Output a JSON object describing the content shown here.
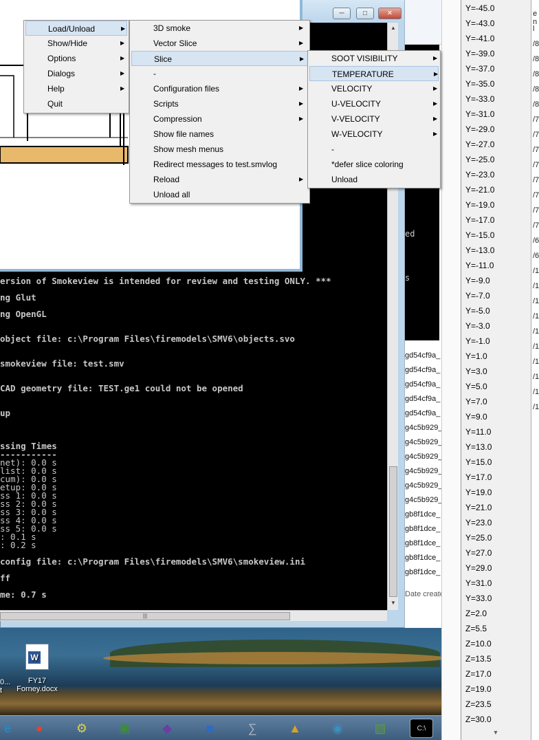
{
  "console": {
    "lines": [
      {
        "text": "ersion of Smokeview is intended for review and testing ONLY. ***",
        "bold": true
      },
      {
        "text": "ng Glut",
        "bold": true
      },
      {
        "text": "ng OpenGL",
        "bold": true
      },
      {
        "text": "object file: c:\\Program Files\\firemodels\\SMV6\\objects.svo",
        "bold": true
      },
      {
        "text": "smokeview file: test.smv",
        "bold": true
      },
      {
        "text": "CAD geometry file: TEST.ge1 could not be opened",
        "bold": true
      },
      {
        "text": "up",
        "bold": true
      },
      {
        "text": "ssing Times",
        "bold": true
      },
      {
        "text": "-----------",
        "bold": true
      },
      {
        "text": "net): 0.0 s",
        "bold": false
      },
      {
        "text": "list: 0.0 s",
        "bold": false
      },
      {
        "text": "cum): 0.0 s",
        "bold": false
      },
      {
        "text": "etup: 0.0 s",
        "bold": false
      },
      {
        "text": "ss 1: 0.0 s",
        "bold": false
      },
      {
        "text": "ss 2: 0.0 s",
        "bold": false
      },
      {
        "text": "ss 3: 0.0 s",
        "bold": false
      },
      {
        "text": "ss 4: 0.0 s",
        "bold": false
      },
      {
        "text": "ss 5: 0.0 s",
        "bold": false
      },
      {
        "text": ": 0.1 s",
        "bold": false
      },
      {
        "text": ": 0.2 s",
        "bold": false
      },
      {
        "text": "config file: c:\\Program Files\\firemodels\\SMV6\\smokeview.ini",
        "bold": true
      },
      {
        "text": "ff",
        "bold": true
      },
      {
        "text": "me: 0.7 s",
        "bold": true
      }
    ]
  },
  "explorer": {
    "pane_text": [
      "ed",
      "s"
    ],
    "files": [
      "gd54cf9a_",
      "gd54cf9a_",
      "gd54cf9a_",
      "gd54cf9a_",
      "gd54cf9a_",
      "g4c5b929_",
      "g4c5b929_",
      "g4c5b929_",
      "g4c5b929_",
      "g4c5b929_",
      "g4c5b929_",
      "gb8f1dce_",
      "gb8f1dce_",
      "gb8f1dce_",
      "gb8f1dce_",
      "gb8f1dce_"
    ],
    "date_col": "Date create"
  },
  "main_menu": {
    "items": [
      {
        "label": "Load/Unload",
        "submenu": true
      },
      {
        "label": "Show/Hide",
        "submenu": true
      },
      {
        "label": "Options",
        "submenu": true
      },
      {
        "label": "Dialogs",
        "submenu": true
      },
      {
        "label": "Help",
        "submenu": true
      },
      {
        "label": "Quit",
        "submenu": false
      }
    ]
  },
  "load_menu": {
    "items": [
      {
        "label": "3D smoke",
        "submenu": true
      },
      {
        "label": "Vector Slice",
        "submenu": true
      },
      {
        "label": "Slice",
        "submenu": true
      },
      {
        "label": "-",
        "submenu": false
      },
      {
        "label": "Configuration files",
        "submenu": true
      },
      {
        "label": "Scripts",
        "submenu": true
      },
      {
        "label": "Compression",
        "submenu": true
      },
      {
        "label": "Show file names",
        "submenu": false
      },
      {
        "label": "Show mesh menus",
        "submenu": false
      },
      {
        "label": "Redirect messages to test.smvlog",
        "submenu": false
      },
      {
        "label": "Reload",
        "submenu": true
      },
      {
        "label": "Unload all",
        "submenu": false
      }
    ]
  },
  "slice_menu": {
    "items": [
      {
        "label": "SOOT VISIBILITY",
        "submenu": true
      },
      {
        "label": "TEMPERATURE",
        "submenu": true
      },
      {
        "label": "VELOCITY",
        "submenu": true
      },
      {
        "label": "U-VELOCITY",
        "submenu": true
      },
      {
        "label": "V-VELOCITY",
        "submenu": true
      },
      {
        "label": "W-VELOCITY",
        "submenu": true
      },
      {
        "label": "-",
        "submenu": false
      },
      {
        "label": " *defer slice coloring",
        "submenu": false
      },
      {
        "label": "Unload",
        "submenu": false
      }
    ]
  },
  "temperature_menu": {
    "items": [
      "Y=-45.0",
      "Y=-43.0",
      "Y=-41.0",
      "Y=-39.0",
      "Y=-37.0",
      "Y=-35.0",
      "Y=-33.0",
      "Y=-31.0",
      "Y=-29.0",
      "Y=-27.0",
      "Y=-25.0",
      "Y=-23.0",
      "Y=-21.0",
      "Y=-19.0",
      "Y=-17.0",
      "Y=-15.0",
      "Y=-13.0",
      "Y=-11.0",
      "Y=-9.0",
      "Y=-7.0",
      "Y=-5.0",
      "Y=-3.0",
      "Y=-1.0",
      "Y=1.0",
      "Y=3.0",
      "Y=5.0",
      "Y=7.0",
      "Y=9.0",
      "Y=11.0",
      "Y=13.0",
      "Y=15.0",
      "Y=17.0",
      "Y=19.0",
      "Y=21.0",
      "Y=23.0",
      "Y=25.0",
      "Y=27.0",
      "Y=29.0",
      "Y=31.0",
      "Y=33.0",
      "Z=2.0",
      "Z=5.5",
      "Z=10.0",
      "Z=13.5",
      "Z=17.0",
      "Z=19.0",
      "Z=23.5",
      "Z=30.0"
    ]
  },
  "right_edge_text": [
    "e n",
    "l",
    "/8",
    "/8",
    "/8",
    "/8",
    "/8",
    "/7",
    "/7",
    "/7",
    "/7",
    "/7",
    "/7",
    "/7",
    "/7",
    "/6",
    "/6",
    "/1",
    "/1",
    "/1",
    "/1",
    "/1",
    "/1",
    "/1",
    "/1",
    "/1",
    "/1"
  ],
  "desktop": {
    "icon_label_1": "FY17",
    "icon_label_2": "Forney.docx",
    "partial_label_1": "0...",
    "partial_label_2": "t"
  },
  "taskbar": {
    "icons": [
      "ie-icon",
      "chrome-icon",
      "network-tool-icon",
      "monitor-app-icon",
      "visual-studio-icon",
      "computer-icon",
      "math-app-icon",
      "lock-app-icon",
      "globe-app-icon",
      "map-app-icon",
      "cmd-icon"
    ]
  }
}
